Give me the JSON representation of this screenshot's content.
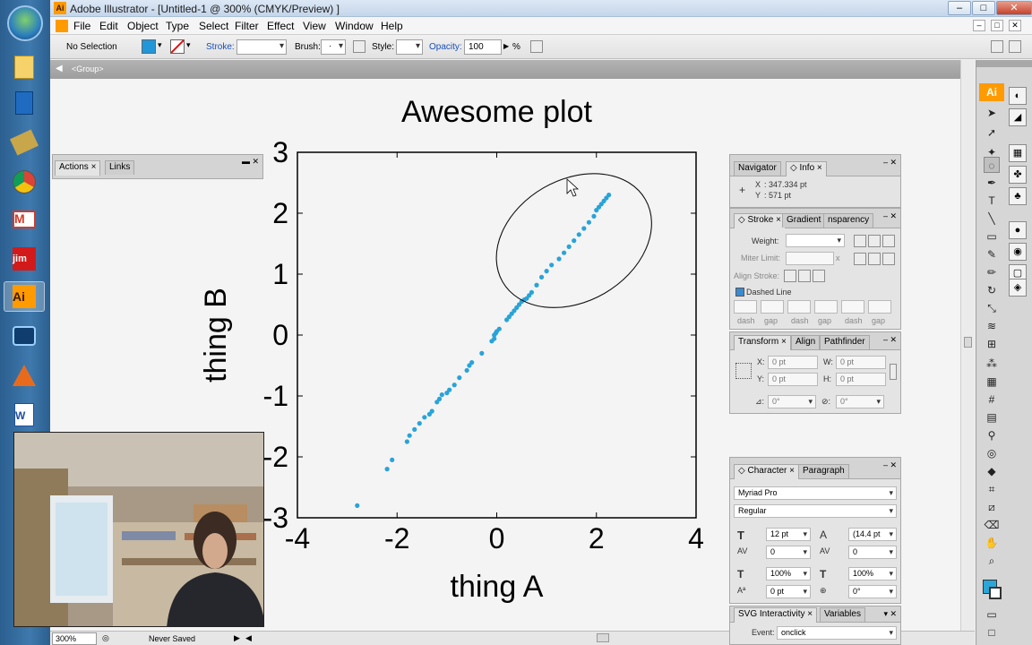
{
  "titlebar": {
    "title": "Adobe Illustrator - [Untitled-1 @ 300% (CMYK/Preview) ]",
    "icon": "illustrator-icon",
    "minimize": "–",
    "maximize": "□",
    "close": "✕"
  },
  "menubar": {
    "items": [
      "File",
      "Edit",
      "Object",
      "Type",
      "Select",
      "Filter",
      "Effect",
      "View",
      "Window",
      "Help"
    ],
    "right_buttons": [
      "–",
      "□",
      "✕"
    ]
  },
  "controlbar": {
    "selection": "No Selection",
    "fill_color": "#2196d8",
    "stroke_label": "Stroke:",
    "brush_label": "Brush:",
    "brush_value": "·",
    "style_label": "Style:",
    "opacity_label": "Opacity:",
    "opacity_value": "100",
    "opacity_unit": "%"
  },
  "document": {
    "breadcrumb": "<Group>",
    "plot": {
      "title": "Awesome plot",
      "xlabel": "thing A",
      "ylabel": "thing B",
      "xticks": [
        "-4",
        "-2",
        "0",
        "2",
        "4"
      ],
      "yticks": [
        "3",
        "2",
        "1",
        "0",
        "-1",
        "-2",
        "-3"
      ]
    }
  },
  "chart_data": {
    "type": "scatter",
    "title": "Awesome plot",
    "xlabel": "thing A",
    "ylabel": "thing B",
    "xlim": [
      -4,
      4
    ],
    "ylim": [
      -3,
      3
    ],
    "color": "#29a3d8",
    "points": [
      [
        -2.8,
        -2.8
      ],
      [
        -2.2,
        -2.2
      ],
      [
        -2.1,
        -2.05
      ],
      [
        -1.8,
        -1.75
      ],
      [
        -1.75,
        -1.65
      ],
      [
        -1.65,
        -1.55
      ],
      [
        -1.55,
        -1.45
      ],
      [
        -1.45,
        -1.35
      ],
      [
        -1.35,
        -1.3
      ],
      [
        -1.3,
        -1.25
      ],
      [
        -1.2,
        -1.1
      ],
      [
        -1.15,
        -1.05
      ],
      [
        -1.1,
        -0.98
      ],
      [
        -1.0,
        -0.95
      ],
      [
        -0.95,
        -0.9
      ],
      [
        -0.85,
        -0.82
      ],
      [
        -0.75,
        -0.7
      ],
      [
        -0.6,
        -0.58
      ],
      [
        -0.55,
        -0.5
      ],
      [
        -0.5,
        -0.45
      ],
      [
        -0.3,
        -0.3
      ],
      [
        -0.1,
        -0.1
      ],
      [
        -0.05,
        -0.06
      ],
      [
        -0.05,
        0.0
      ],
      [
        -0.02,
        0.03
      ],
      [
        0.0,
        0.06
      ],
      [
        0.05,
        0.1
      ],
      [
        0.2,
        0.25
      ],
      [
        0.25,
        0.3
      ],
      [
        0.3,
        0.35
      ],
      [
        0.35,
        0.4
      ],
      [
        0.4,
        0.45
      ],
      [
        0.45,
        0.5
      ],
      [
        0.5,
        0.55
      ],
      [
        0.55,
        0.58
      ],
      [
        0.6,
        0.6
      ],
      [
        0.65,
        0.65
      ],
      [
        0.7,
        0.7
      ],
      [
        0.8,
        0.82
      ],
      [
        0.9,
        0.95
      ],
      [
        1.0,
        1.05
      ],
      [
        1.1,
        1.15
      ],
      [
        1.25,
        1.25
      ],
      [
        1.35,
        1.35
      ],
      [
        1.45,
        1.45
      ],
      [
        1.55,
        1.55
      ],
      [
        1.65,
        1.65
      ],
      [
        1.75,
        1.75
      ],
      [
        1.85,
        1.85
      ],
      [
        1.95,
        1.95
      ],
      [
        2.0,
        2.05
      ],
      [
        2.05,
        2.1
      ],
      [
        2.1,
        2.15
      ],
      [
        2.15,
        2.2
      ],
      [
        2.2,
        2.25
      ],
      [
        2.25,
        2.3
      ]
    ]
  },
  "panels": {
    "actions": {
      "tabs": [
        "Actions",
        "Links"
      ]
    },
    "navigator": {
      "tabs": [
        "Navigator",
        "Info"
      ],
      "x_label": "X",
      "x_value": ": 347.334 pt",
      "y_label": "Y",
      "y_value": ": 571 pt"
    },
    "stroke": {
      "tabs": [
        "Stroke",
        "Gradient",
        "nsparency"
      ],
      "weight": "Weight:",
      "miter": "Miter Limit:",
      "miter_unit": "x",
      "align": "Align Stroke:",
      "dashed": "Dashed Line",
      "dash_labels": [
        "dash",
        "gap",
        "dash",
        "gap",
        "dash",
        "gap"
      ]
    },
    "transform": {
      "tabs": [
        "Transform",
        "Align",
        "Pathfinder"
      ],
      "x_label": "X:",
      "x_value": "0 pt",
      "y_label": "Y:",
      "y_value": "0 pt",
      "w_label": "W:",
      "w_value": "0 pt",
      "h_label": "H:",
      "h_value": "0 pt",
      "rot_value": "0°",
      "shear_value": "0°"
    },
    "character": {
      "tabs": [
        "Character",
        "Paragraph"
      ],
      "font": "Myriad Pro",
      "style": "Regular",
      "size": "12 pt",
      "leading": "(14.4 pt",
      "kerning": "0",
      "tracking": "0",
      "vscale": "100%",
      "hscale": "100%",
      "baseline": "0 pt",
      "rotation": "0°"
    },
    "svg": {
      "tabs": [
        "SVG Interactivity",
        "Variables"
      ],
      "event_label": "Event:",
      "event_value": "onclick"
    }
  },
  "statusbar": {
    "zoom": "300%",
    "status": "Never Saved"
  },
  "tools": {
    "badge": "Ai"
  },
  "taskbar": {
    "apps": [
      "explorer-icon",
      "windows-media-icon",
      "paint-icon",
      "chrome-icon",
      "gmail-icon",
      "jim-icon",
      "illustrator-icon",
      "webcam-app-icon",
      "matlab-icon",
      "word-icon"
    ],
    "ai_label": "Ai"
  }
}
